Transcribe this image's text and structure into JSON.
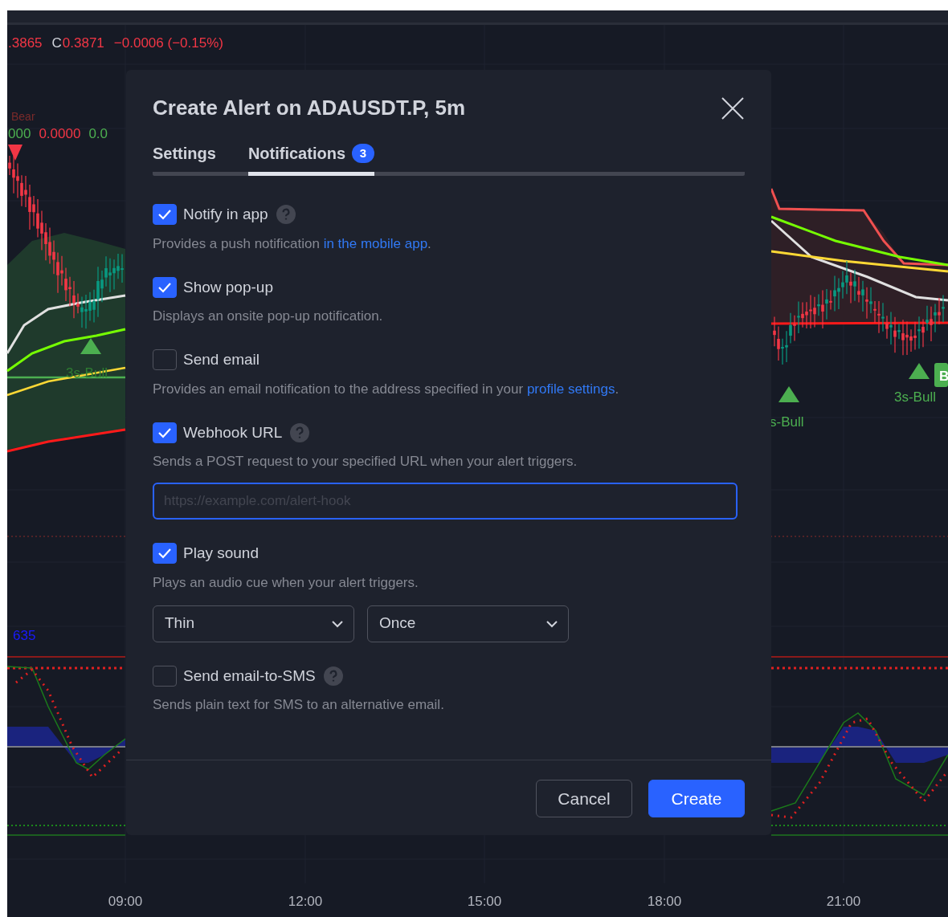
{
  "chart": {
    "legend": [
      {
        "kind": "value",
        "text": ".3865"
      },
      {
        "kind": "key",
        "text": "C"
      },
      {
        "kind": "value",
        "text": "0.3871"
      },
      {
        "kind": "change",
        "text": "−0.0006 (−0.15%)"
      }
    ],
    "indicator_name": "Bear",
    "indicator_values": [
      {
        "text": "000",
        "color": "#4caf50"
      },
      {
        "text": "0.0000",
        "color": "#f23645"
      },
      {
        "text": "0.0",
        "color": "#4caf50"
      }
    ],
    "signal_labels": [
      "3s-Bull",
      "s-Bull",
      "3s-Bull"
    ],
    "signal_badge": "B",
    "oscillator_value": "635",
    "time_axis": [
      "09:00",
      "12:00",
      "15:00",
      "18:00",
      "21:00"
    ]
  },
  "dialog": {
    "title": "Create Alert on ADAUSDT.P, 5m",
    "tabs": [
      {
        "label": "Settings",
        "selected": false
      },
      {
        "label": "Notifications",
        "selected": true,
        "badge": "3"
      }
    ],
    "options": [
      {
        "kind": "plain",
        "label": "Notify in app",
        "checked": true,
        "help": true,
        "description": [
          {
            "text": "Provides a push notification ",
            "link": false
          },
          {
            "text": "in the mobile app",
            "link": true
          },
          {
            "text": ".",
            "link": false
          }
        ]
      },
      {
        "kind": "plain",
        "label": "Show pop-up",
        "checked": true,
        "help": false,
        "description": [
          {
            "text": "Displays an onsite pop-up notification.",
            "link": false
          }
        ]
      },
      {
        "kind": "plain",
        "label": "Send email",
        "checked": false,
        "help": false,
        "description": [
          {
            "text": "Provides an email notification to the address specified in your ",
            "link": false
          },
          {
            "text": "profile settings",
            "link": true
          },
          {
            "text": ".",
            "link": false
          }
        ]
      },
      {
        "kind": "field",
        "label": "Webhook URL",
        "checked": true,
        "help": true,
        "description": [
          {
            "text": "Sends a POST request to your specified URL when your alert triggers.",
            "link": false
          }
        ],
        "field": {
          "placeholder": "https://example.com/alert-hook",
          "focused": true
        }
      },
      {
        "kind": "selects",
        "label": "Play sound",
        "checked": true,
        "help": false,
        "description": [
          {
            "text": "Plays an audio cue when your alert triggers.",
            "link": false
          }
        ],
        "selects": [
          "Thin",
          "Once"
        ]
      },
      {
        "kind": "plain",
        "label": "Send email-to-SMS",
        "checked": false,
        "help": true,
        "description": [
          {
            "text": "Sends plain text for SMS to an alternative email.",
            "link": false
          }
        ]
      }
    ],
    "buttons": [
      {
        "label": "Cancel",
        "kind": "secondary"
      },
      {
        "label": "Create",
        "kind": "primary"
      }
    ]
  }
}
